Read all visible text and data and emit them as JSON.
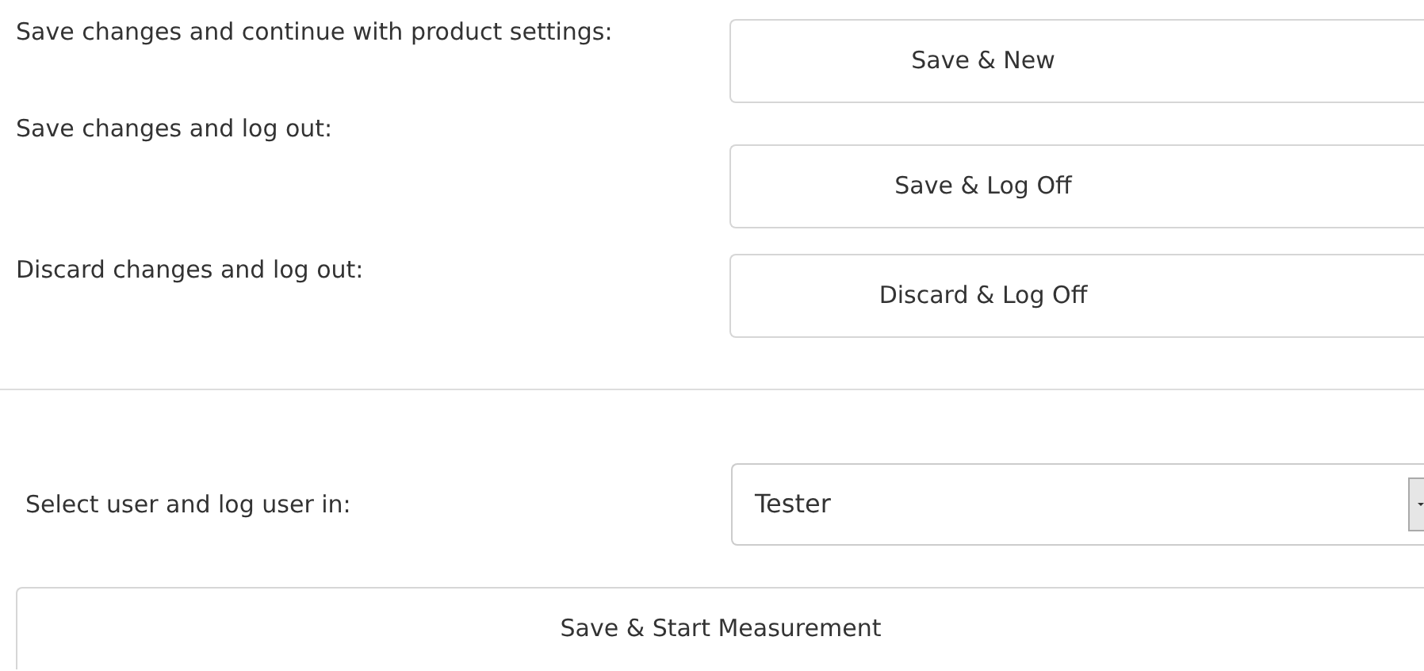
{
  "actions": [
    {
      "label": "Save changes and continue with product settings:",
      "button": "Save & New"
    },
    {
      "label": "Save changes and log out:",
      "button": "Save & Log Off"
    },
    {
      "label": "Discard changes and log out:",
      "button": "Discard & Log Off"
    }
  ],
  "user_select": {
    "label": "Select user and log user in:",
    "value": "Tester"
  },
  "start_button": "Save & Start Measurement"
}
